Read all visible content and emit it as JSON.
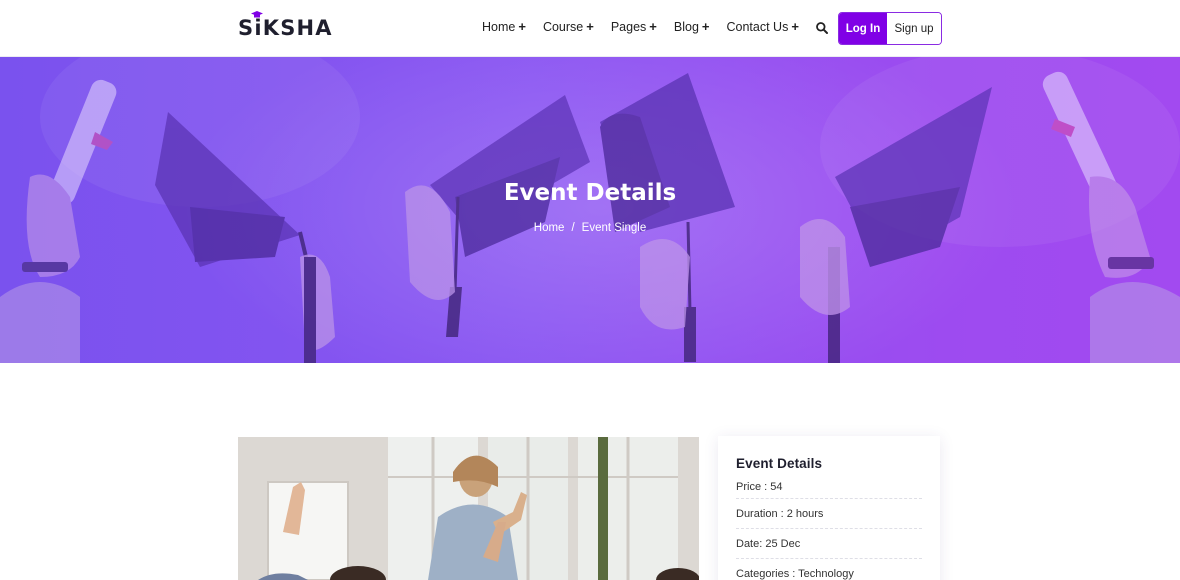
{
  "logo": {
    "text_pre": "S",
    "text_i": "i",
    "text_post": "KSHA"
  },
  "nav": [
    {
      "label": "Home",
      "plus": "+"
    },
    {
      "label": "Course",
      "plus": "+"
    },
    {
      "label": "Pages",
      "plus": "+"
    },
    {
      "label": "Blog",
      "plus": "+"
    },
    {
      "label": "Contact Us",
      "plus": "+"
    }
  ],
  "auth": {
    "login": "Log In",
    "signup": "Sign up"
  },
  "banner": {
    "title": "Event Details",
    "breadcrumb": {
      "home": "Home",
      "separator": "/",
      "current": "Event Single"
    }
  },
  "sidebar": {
    "title": "Event Details",
    "rows": [
      "Price : 54",
      "Duration : 2 hours",
      "Date: 25 Dec",
      "Categories : Technology"
    ]
  },
  "colors": {
    "accent": "#8000e6",
    "banner_start": "#7a52ee",
    "banner_end": "#a24af0"
  }
}
